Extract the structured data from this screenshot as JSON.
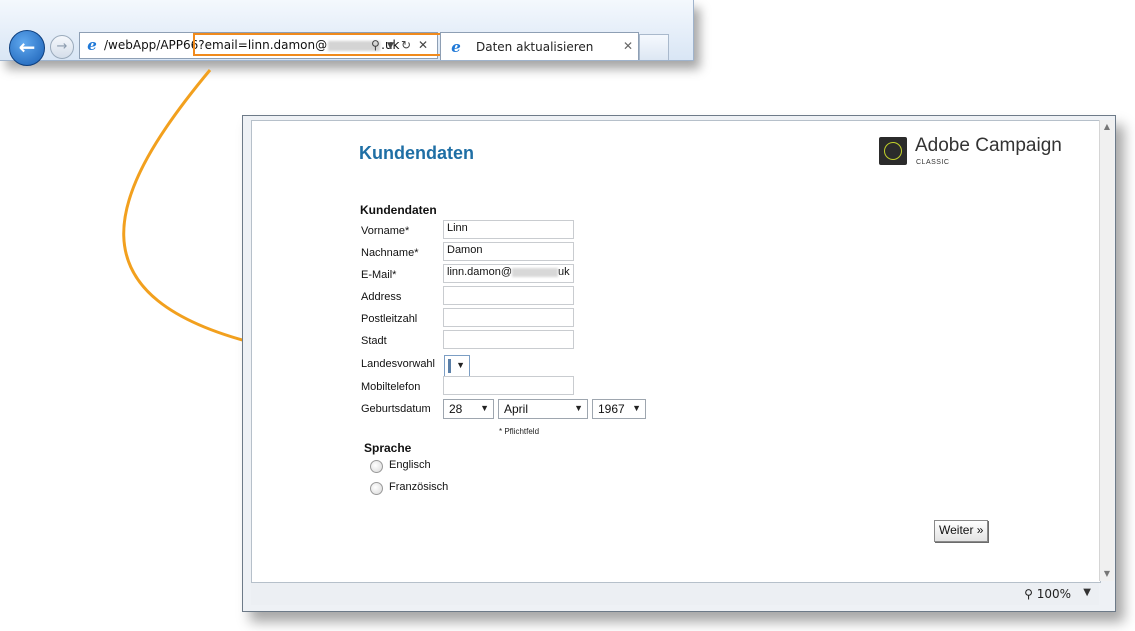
{
  "browser": {
    "address_url_prefix": "/webApp/APP66",
    "address_url_param": "?email=linn.damon@",
    "address_url_suffix": ".uk",
    "tab_title": "Daten aktualisieren"
  },
  "page": {
    "title": "Kundendaten",
    "logo_name": "Adobe Campaign",
    "logo_sub": "CLASSIC",
    "section_title": "Kundendaten",
    "fields": [
      {
        "label": "Vorname*",
        "value": "Linn"
      },
      {
        "label": "Nachname*",
        "value": "Damon"
      },
      {
        "label": "E-Mail*",
        "value_prefix": "linn.damon@",
        "value_suffix": "uk"
      },
      {
        "label": "Address",
        "value": ""
      },
      {
        "label": "Postleitzahl",
        "value": ""
      },
      {
        "label": "Stadt",
        "value": ""
      },
      {
        "label": "Landesvorwahl"
      },
      {
        "label": "Mobiltelefon",
        "value": ""
      },
      {
        "label": "Geburtsdatum"
      }
    ],
    "birth_day": "28",
    "birth_month": "April",
    "birth_year": "1967",
    "mandatory_note": "* Pflichtfeld",
    "language_title": "Sprache",
    "languages": [
      "Englisch",
      "Französisch"
    ],
    "next_button": "Weiter »"
  },
  "status": {
    "zoom": "100%"
  },
  "colors": {
    "title_blue": "#1f6fa5",
    "highlight_orange": "#f08a1c",
    "arrow_orange": "#f2a01e"
  }
}
